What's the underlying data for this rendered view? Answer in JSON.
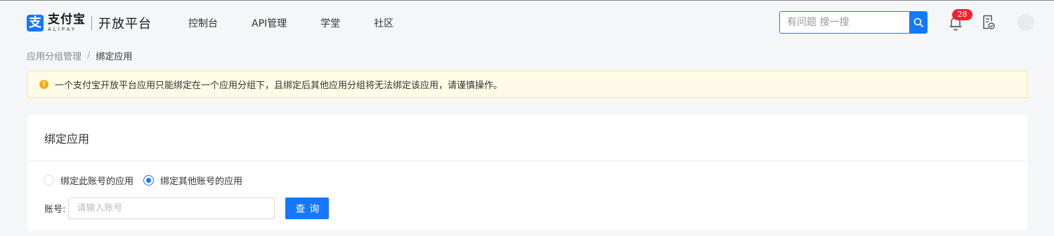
{
  "header": {
    "logo": {
      "mark": "支",
      "brand_cn": "支付宝",
      "brand_en": "ALIPAY",
      "platform": "开放平台"
    },
    "nav": [
      {
        "label": "控制台"
      },
      {
        "label": "API管理"
      },
      {
        "label": "学堂"
      },
      {
        "label": "社区"
      }
    ],
    "search": {
      "placeholder": "有问题 搜一搜"
    },
    "notification_count": "28",
    "accent_color": "#1677ff"
  },
  "breadcrumb": {
    "parent": "应用分组管理",
    "separator": "/",
    "current": "绑定应用"
  },
  "notice": {
    "icon": "warning-icon",
    "text": "一个支付宝开放平台应用只能绑定在一个应用分组下，且绑定后其他应用分组将无法绑定该应用，请谨慎操作。"
  },
  "card": {
    "title": "绑定应用",
    "radio_options": [
      {
        "label": "绑定此账号的应用",
        "checked": false
      },
      {
        "label": "绑定其他账号的应用",
        "checked": true
      }
    ],
    "account": {
      "label": "账号:",
      "placeholder": "请输入账号",
      "value": ""
    },
    "query_button": "查询"
  }
}
